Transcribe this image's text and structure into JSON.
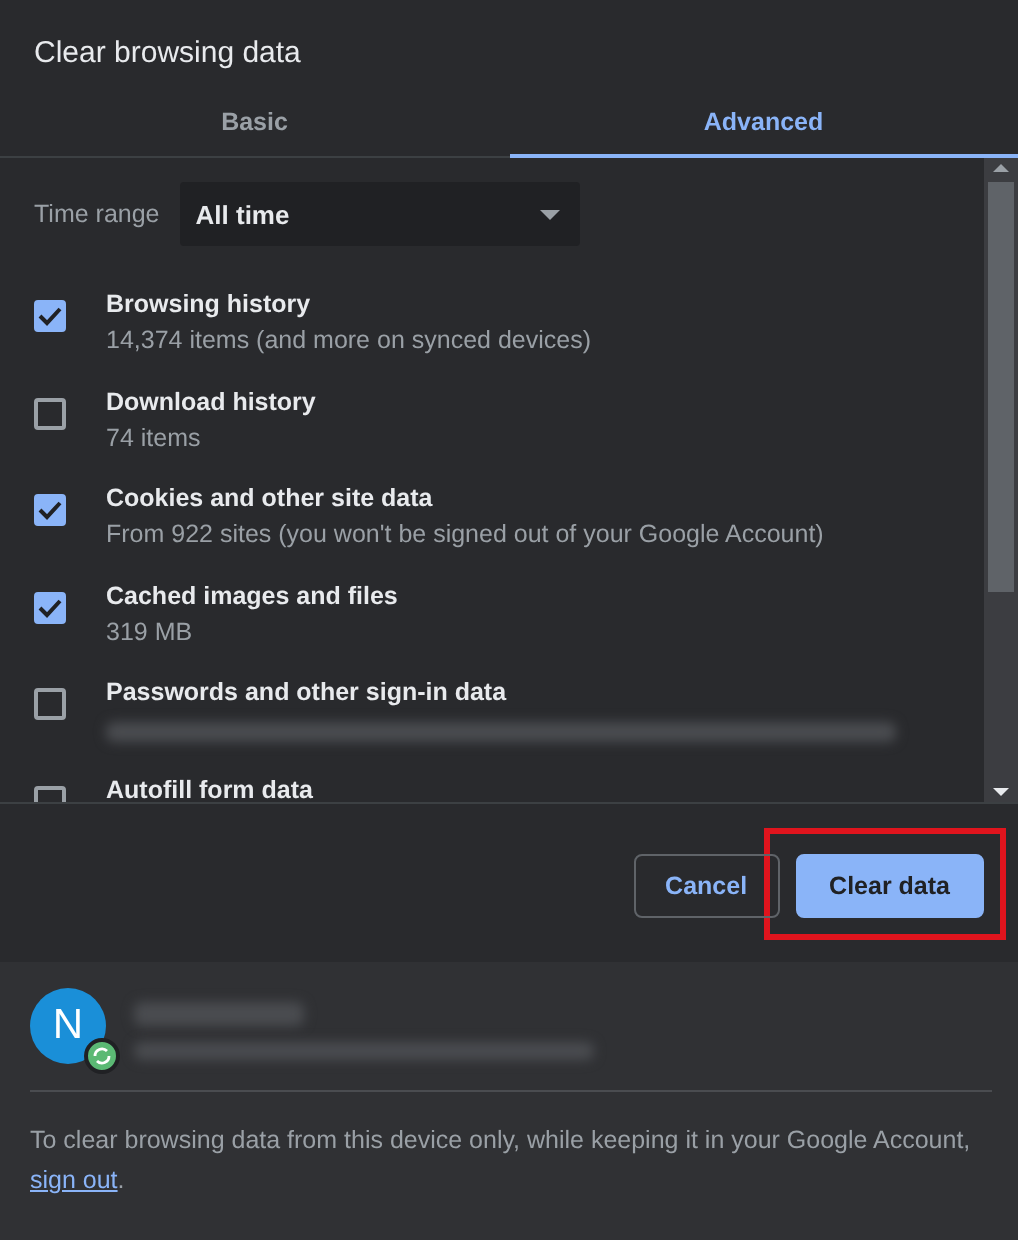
{
  "dialog": {
    "title": "Clear browsing data"
  },
  "tabs": [
    {
      "label": "Basic",
      "selected": false
    },
    {
      "label": "Advanced",
      "selected": true
    }
  ],
  "time_range": {
    "label": "Time range",
    "value": "All time"
  },
  "items": [
    {
      "label": "Browsing history",
      "description": "14,374 items (and more on synced devices)",
      "checked": true
    },
    {
      "label": "Download history",
      "description": "74 items",
      "checked": false
    },
    {
      "label": "Cookies and other site data",
      "description": "From 922 sites (you won't be signed out of your Google Account)",
      "checked": true
    },
    {
      "label": "Cached images and files",
      "description": "319 MB",
      "checked": true
    },
    {
      "label": "Passwords and other sign-in data",
      "redacted": true,
      "checked": false
    },
    {
      "label": "Autofill form data",
      "checked": false
    }
  ],
  "buttons": [
    {
      "label": "Cancel",
      "kind": "secondary",
      "highlighted": false
    },
    {
      "label": "Clear data",
      "kind": "primary",
      "highlighted": true
    }
  ],
  "account": {
    "initial": "N",
    "syncing": true,
    "redacted": true
  },
  "footer": {
    "text": "To clear browsing data from this device only, while keeping it in your Google Account, ",
    "link": "sign out",
    "after": "."
  }
}
